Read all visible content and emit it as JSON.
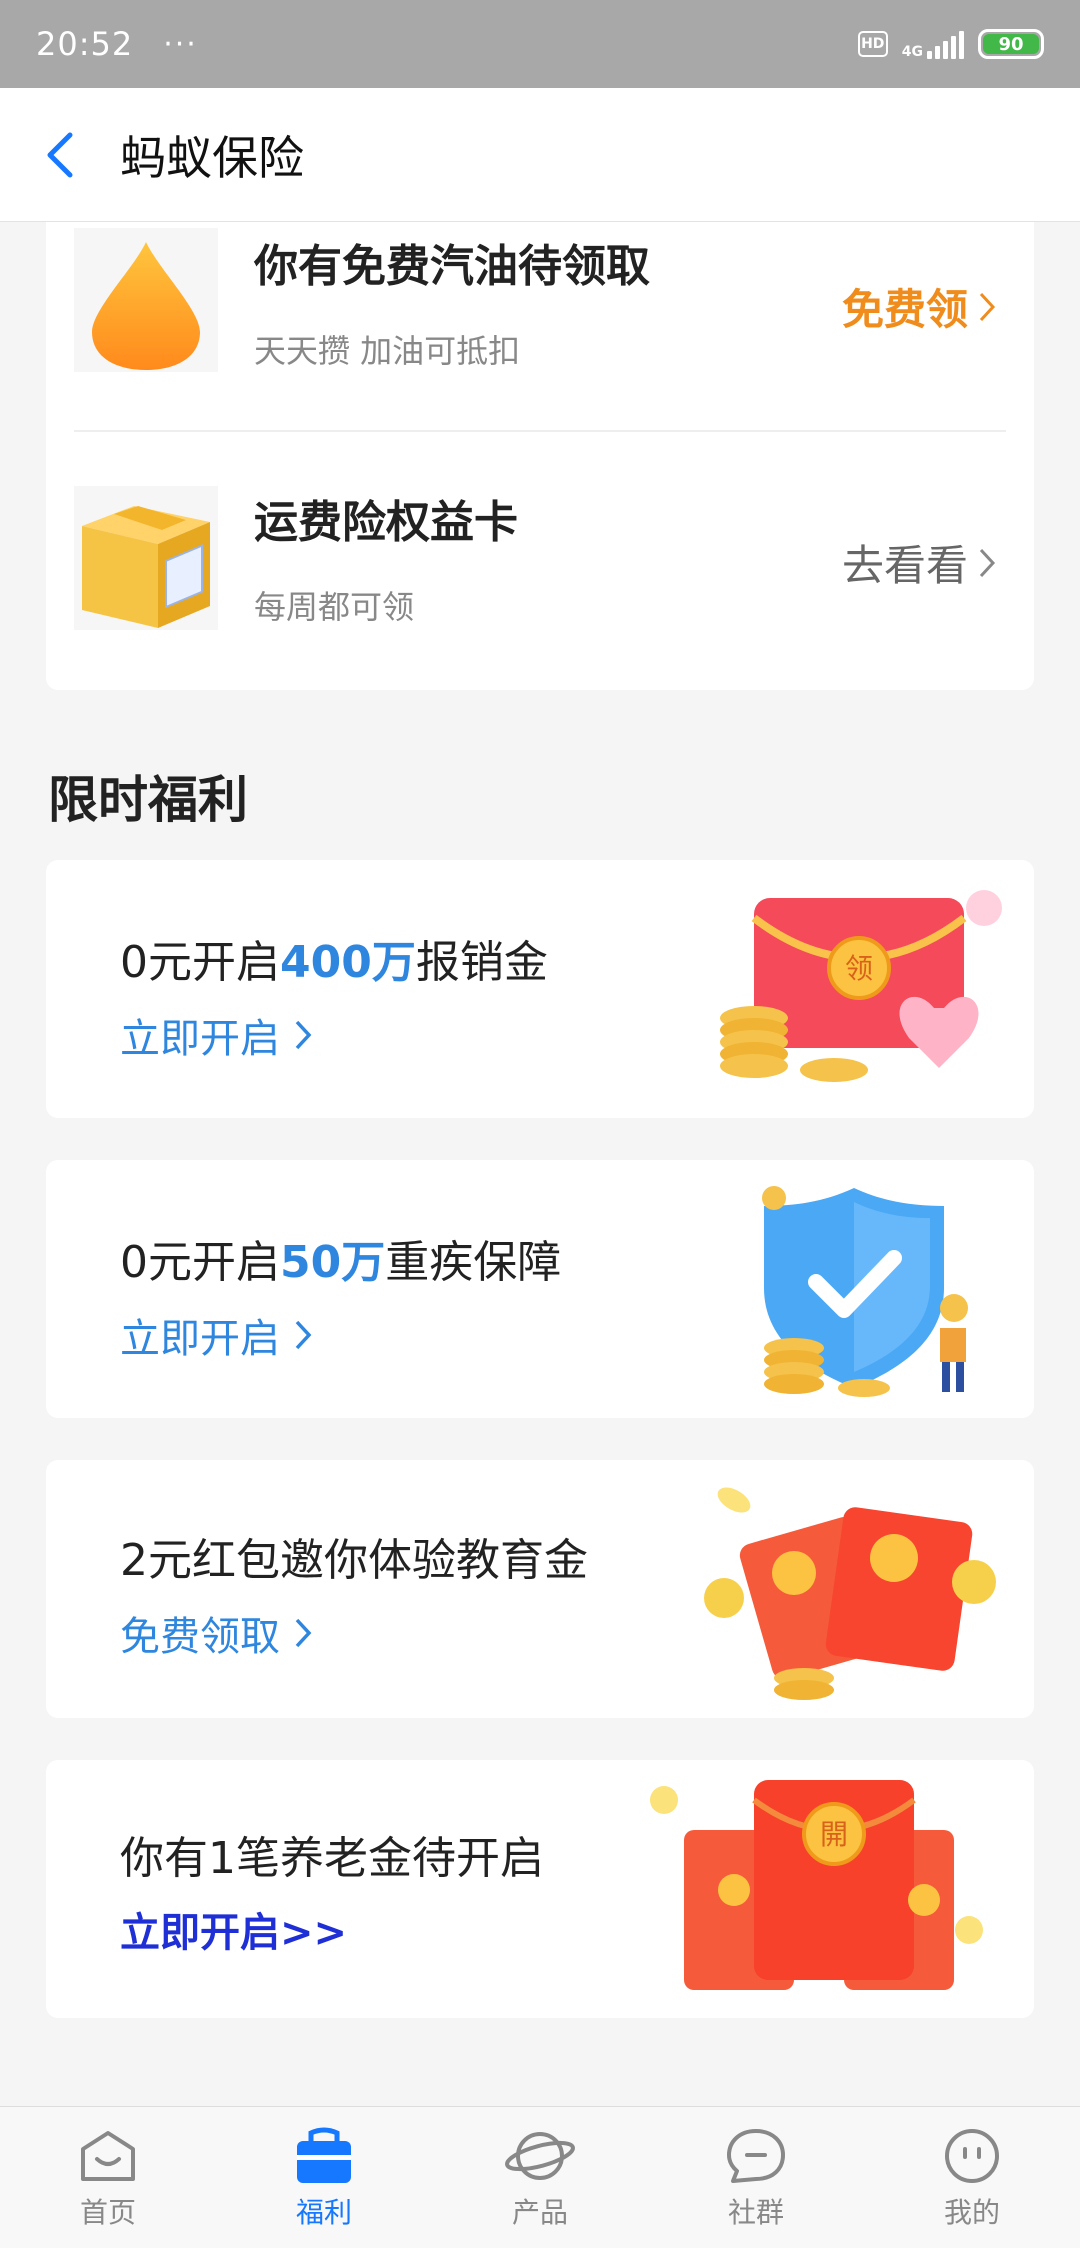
{
  "status_bar": {
    "time": "20:52",
    "dots": "···",
    "hd": "HD",
    "network": "4G",
    "battery": "90"
  },
  "nav": {
    "title": "蚂蚁保险"
  },
  "benefits": [
    {
      "title": "你有免费汽油待领取",
      "subtitle": "天天攒 加油可抵扣",
      "action": "免费领",
      "action_color": "#f08c1c",
      "icon": "oil-drop-icon"
    },
    {
      "title": "运费险权益卡",
      "subtitle": "每周都可领",
      "action": "去看看",
      "action_color": "#666666",
      "icon": "package-box-icon"
    }
  ],
  "section": {
    "title": "限时福利"
  },
  "promos": [
    {
      "title_pre": "0元开启",
      "title_hl": "400万",
      "title_post": "报销金",
      "link": "立即开启",
      "art": "red-envelope-coins-icon"
    },
    {
      "title_pre": "0元开启",
      "title_hl": "50万",
      "title_post": "重疾保障",
      "link": "立即开启",
      "art": "shield-check-icon"
    },
    {
      "title_pre": "2元红包邀你体验教育金",
      "title_hl": "",
      "title_post": "",
      "link": "免费领取",
      "art": "red-envelopes-icon"
    },
    {
      "title_pre": "你有1笔养老金待开启",
      "title_hl": "",
      "title_post": "",
      "link": "立即开启>>",
      "art": "open-envelope-icon"
    }
  ],
  "tabs": [
    {
      "label": "首页",
      "icon": "home-icon",
      "active": false
    },
    {
      "label": "福利",
      "icon": "gift-bag-icon",
      "active": true
    },
    {
      "label": "产品",
      "icon": "planet-icon",
      "active": false
    },
    {
      "label": "社群",
      "icon": "chat-bubble-icon",
      "active": false
    },
    {
      "label": "我的",
      "icon": "smiley-icon",
      "active": false
    }
  ],
  "colors": {
    "accent": "#1677ff",
    "link_blue": "#2e86de",
    "orange": "#f08c1c",
    "statusbar": "#a8a8a8"
  }
}
